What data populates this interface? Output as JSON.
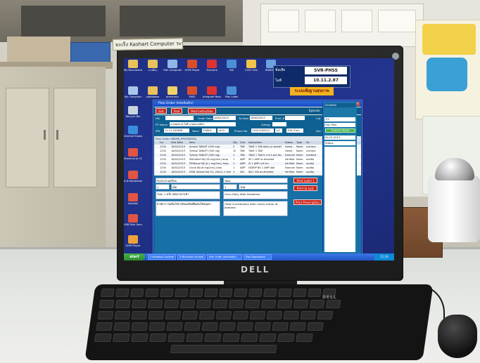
{
  "sticker": {
    "text": "มะเร็ง Kashart Computer ระบบ..."
  },
  "monitor": {
    "brand": "DELL"
  },
  "keyboard": {
    "brand": "DELL"
  },
  "desktop": {
    "icons": [
      {
        "label": "My Documents",
        "color": "#e8c25a"
      },
      {
        "label": "งานอื่นๆ",
        "color": "#e8c25a"
      },
      {
        "label": "VNC Computer",
        "color": "#8fb6e8"
      },
      {
        "label": "GOM Player",
        "color": "#d94f2a"
      },
      {
        "label": "TrueCare",
        "color": "#d33"
      },
      {
        "label": "SW",
        "color": "#4b8fd6"
      },
      {
        "label": "CCPC Info",
        "color": "#f0c34a"
      },
      {
        "label": "WINDOW",
        "color": "#6aa3df"
      },
      {
        "label": "My Computer",
        "color": "#a9c7ea"
      },
      {
        "label": "sdatabase",
        "color": "#e8c25a"
      },
      {
        "label": "pharmacy",
        "color": "#f0d16a"
      },
      {
        "label": "PASS",
        "color": "#d94f2a"
      },
      {
        "label": "Integrate Report",
        "color": "#d33"
      },
      {
        "label": "Plan Label",
        "color": "#4b8fd6"
      },
      {
        "label": "Recycle Bin",
        "color": "#c9d4dd"
      },
      {
        "label": "Internet Explorer",
        "color": "#3a8ee0"
      },
      {
        "label": "Shortcut to CCPC_Inst",
        "color": "#e05545"
      },
      {
        "label": "ICIS WinAdmin",
        "color": "#e05545"
      },
      {
        "label": "Intelliax",
        "color": "#e05545"
      },
      {
        "label": "USB Disk Security",
        "color": "#e05545"
      },
      {
        "label": "GOM Player",
        "color": "#f0a23a"
      }
    ],
    "banner": {
      "a": "ข้อเสีย",
      "b": "SVR-PHSS",
      "c": "ไอพี",
      "d": "10.11.2.87",
      "e": "ระบบเพื่อฐานสุขภาพ"
    }
  },
  "app": {
    "title": "Plan Order (IntelliaRx)",
    "toolbar": {
      "exit": "Exit",
      "find": "Find",
      "med": "Med Instruction",
      "episode_label": "Episode",
      "episode_value": "03-11-46812"
    },
    "info": {
      "hn_label": "HN",
      "hn_value": "",
      "order_date_label": "Order Date",
      "order_date_value": "18/02/2013",
      "to_date_label": "To Date",
      "to_date_value": "18/02/2013",
      "print_label": "Print #",
      "cat_label": "Cat",
      "cat_value": "Medicine",
      "name_label": "PT Name",
      "name_value": "นายสมชาย ใจดี นายมหาสมัคร",
      "allergy_label": "Allergy",
      "ipd_label": "IPN",
      "ipd_value": "11-11-439838",
      "ward_label": "Ward",
      "ward_value": "23WHL",
      "bed_value": "1415",
      "phone_label": "Phone No.",
      "phone_value": "13021262012",
      "pg_value": "1/1",
      "time_value": "TH4 (Tim)",
      "doc_label": "Doc Inst",
      "doc_value": "พิมพ์ทอง อรอนงค์"
    },
    "section_title": "Plan Order (MSMS_PROGRESS)",
    "grid": {
      "headers": [
        "Lin",
        "Visit Date",
        "Item",
        "Qty",
        "Unit",
        "Instruction",
        "Status",
        "Type",
        "Dr."
      ],
      "rows": [
        [
          "1234",
          "18/02/2013",
          "Amoxil TABLET (500 mg)",
          "3",
          "TAB",
          "TAKE 1 TAB daily pc breakf",
          "Home-",
          "Norm",
          "numero"
        ],
        [
          "1234",
          "18/02/2013",
          "Tylenol TABLET (500 mg)",
          "10",
          "TAB",
          "TAKE 1 TAB",
          "Home-",
          "Norm",
          "numero"
        ],
        [
          "1234",
          "18/02/2013",
          "Tylenol TABLET (500 mg)",
          "1",
          "TAB",
          "TAKE 1 TAB & 4 hrs pro fev",
          "Execute",
          "Norm",
          "medknd"
        ],
        [
          "1234",
          "18/02/2013",
          "Pethidine INJ (50 mg/1mL) Amp",
          "1",
          "AMP",
          "IM 1 AMP ss directed",
          "Verified",
          "Norm",
          "audita"
        ],
        [
          "1234",
          "18/02/2013",
          "PENtanal INJ (0.1 mg/2mL) Amp",
          "1",
          "AMP",
          "IV 1 AMP q 6 hrs",
          "Verified",
          "Norm",
          "audita"
        ],
        [
          "1234",
          "18/02/2013",
          "Oxcia INJ (6 mg/1mL) Amp",
          "1",
          "AMP",
          "IVDRIP NS 1 AMP dab",
          "Execute",
          "Norm",
          "audita"
        ],
        [
          "1234",
          "18/02/2013",
          "D5W (Dianal INJ 1%, 25mL) 1 Vial",
          "1",
          "VIA",
          "INJ 1 VIA as directed",
          "Verified",
          "Norm",
          "audita"
        ]
      ]
    },
    "lower": {
      "box1": "รับประทานครั้งละ",
      "box1b": "1",
      "box1c": "เม็ด",
      "box2": "วันละ 1 ครั้ง หลังอาหารเช้า",
      "box3": "ถ้ามีอาการคลื่นไส้อาเจียนหรือมีผื่นคันให้หยุดยา",
      "box4": "Take",
      "box4b": "1",
      "box4c": "TAB",
      "box5": "Once Daily After Breakfast",
      "box6": "(Take immediately after meal) and/or at bedtime",
      "btn_print_label1": "Print Label 1",
      "btn_print_lost": "Print to Lost",
      "btn_print_presc": "Print Prescription",
      "btn_change": "Change Lan",
      "select_value": "Thai"
    },
    "side": {
      "header": "0334560",
      "items": [
        "1/1",
        "Grp: Plan",
        "D1.01.2013",
        "Status",
        "",
        "",
        ""
      ],
      "green": "Graphic Sheet"
    }
  },
  "taskbar": {
    "start": "start",
    "tasks": [
      "2 Windows Explorer",
      "3 Microsoft Outlook",
      "Plan Order (IntelliaRx)",
      "Plan Dashboard"
    ],
    "clock": "11:24"
  }
}
